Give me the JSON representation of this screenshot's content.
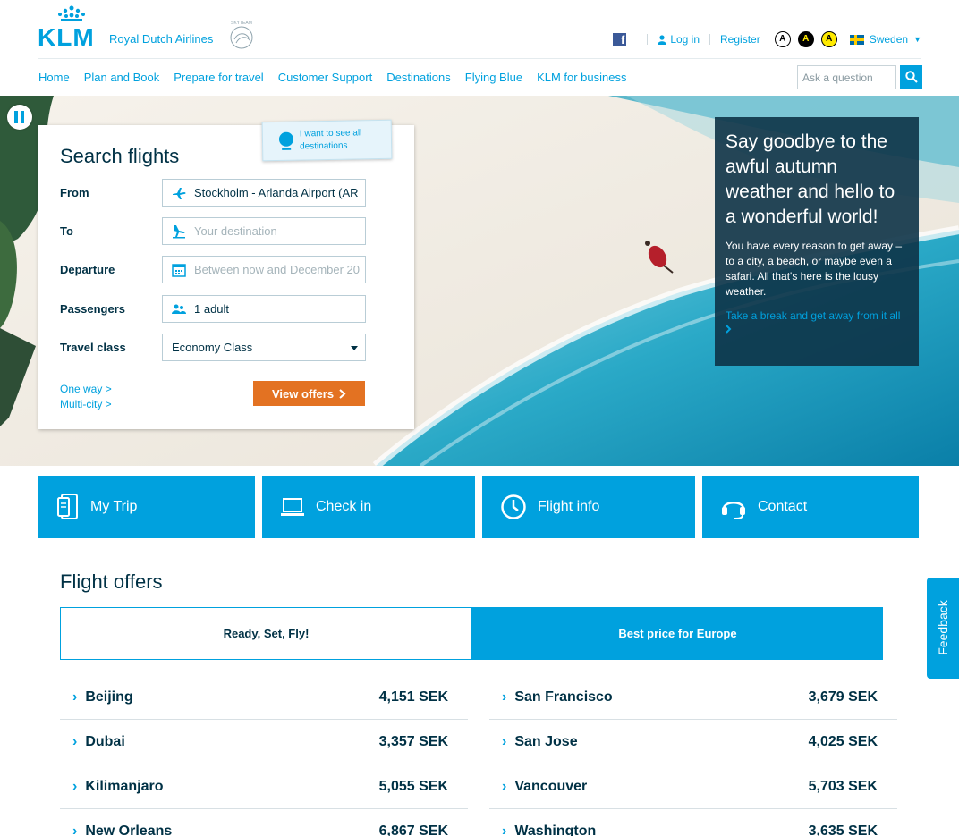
{
  "brand": {
    "name": "KLM",
    "tagline": "Royal Dutch Airlines",
    "alliance": "SKYTEAM"
  },
  "utility": {
    "login": "Log in",
    "register": "Register",
    "accessibility": [
      "A",
      "A",
      "A"
    ],
    "country": "Sweden"
  },
  "nav": {
    "items": [
      "Home",
      "Plan and Book",
      "Prepare for travel",
      "Customer Support",
      "Destinations",
      "Flying Blue",
      "KLM for business"
    ],
    "search_placeholder": "Ask a question"
  },
  "search": {
    "title": "Search flights",
    "destinations_tab": "I want to see all destinations",
    "from_label": "From",
    "from_value": "Stockholm - Arlanda Airport (AR",
    "to_label": "To",
    "to_placeholder": "Your destination",
    "departure_label": "Departure",
    "departure_placeholder": "Between now and December 20",
    "passengers_label": "Passengers",
    "passengers_value": "1 adult",
    "class_label": "Travel class",
    "class_value": "Economy Class",
    "one_way": "One way >",
    "multi_city": "Multi-city >",
    "submit": "View offers"
  },
  "promo": {
    "heading": "Say goodbye to the awful autumn weather and hello to a wonderful world!",
    "body": "You have every reason to get away – to a city, a beach, or maybe even a safari. All that's here is the lousy weather.",
    "link": "Take a break and get away from it all"
  },
  "tiles": [
    "My Trip",
    "Check in",
    "Flight info",
    "Contact"
  ],
  "offers": {
    "title": "Flight offers",
    "tabs": [
      "Ready, Set, Fly!",
      "Best price for Europe"
    ],
    "left": [
      {
        "city": "Beijing",
        "price": "4,151 SEK"
      },
      {
        "city": "Dubai",
        "price": "3,357 SEK"
      },
      {
        "city": "Kilimanjaro",
        "price": "5,055 SEK"
      },
      {
        "city": "New Orleans",
        "price": "6,867 SEK"
      }
    ],
    "right": [
      {
        "city": "San Francisco",
        "price": "3,679 SEK"
      },
      {
        "city": "San Jose",
        "price": "4,025 SEK"
      },
      {
        "city": "Vancouver",
        "price": "5,703 SEK"
      },
      {
        "city": "Washington",
        "price": "3,635 SEK"
      }
    ]
  },
  "feedback": "Feedback",
  "colors": {
    "klm_blue": "#00a1de",
    "navy": "#003145",
    "cta_orange": "#e37222"
  }
}
